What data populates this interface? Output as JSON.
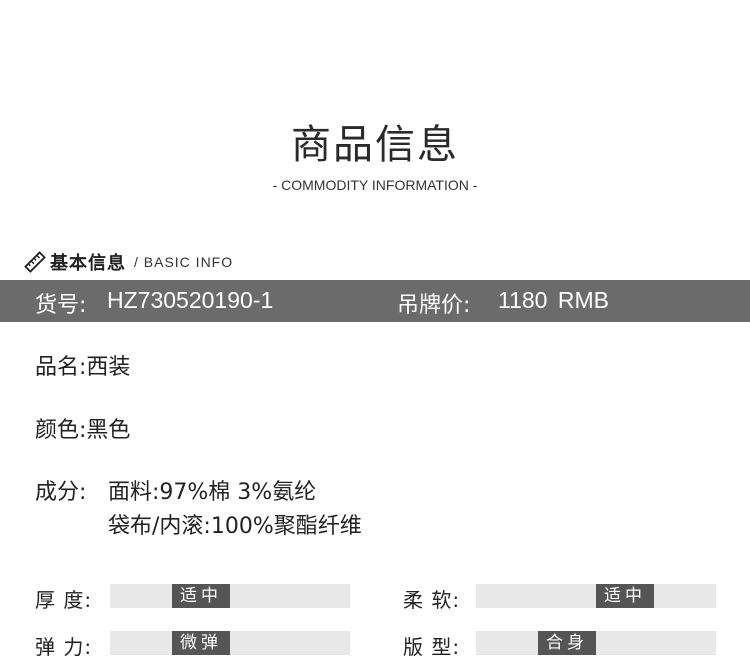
{
  "header": {
    "title": "商品信息",
    "subtitle": "- COMMODITY INFORMATION -"
  },
  "section": {
    "icon": "ruler-icon",
    "title_zh": "基本信息",
    "title_en": "/ BASIC INFO"
  },
  "bar": {
    "sku_label": "货号:",
    "sku_value": "HZ730520190-1",
    "price_label": "吊牌价:",
    "price_value": "1180  RMB",
    "color": "#6b6b6b"
  },
  "details": {
    "name_label": "品名:",
    "name_value": "西装",
    "color_label": "颜色:",
    "color_value": "黑色",
    "composition_label": "成分:",
    "composition_line1": "面料:97%棉 3%氨纶",
    "composition_line2": "袋布/内滚:100%聚酯纤维"
  },
  "attributes": [
    {
      "label": "厚 度:",
      "value": "适中",
      "level": 0.33
    },
    {
      "label": "柔 软:",
      "value": "适中",
      "level": 0.67
    },
    {
      "label": "弹 力:",
      "value": "微弹",
      "level": 0.33
    },
    {
      "label": "版 型:",
      "value": "合身",
      "level": 0.33
    }
  ]
}
